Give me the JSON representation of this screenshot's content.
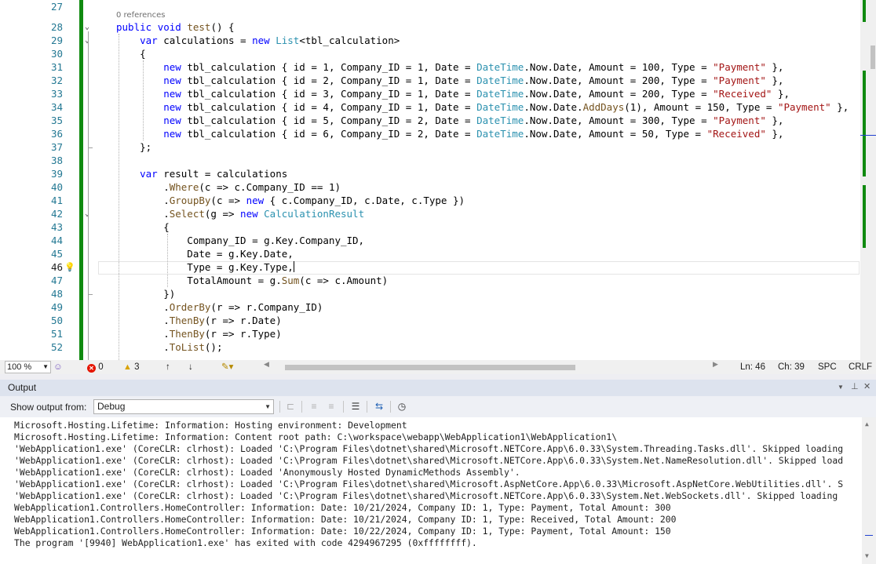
{
  "editor": {
    "references": "0 references",
    "line_numbers": [
      "27",
      "28",
      "29",
      "30",
      "31",
      "32",
      "33",
      "34",
      "35",
      "36",
      "37",
      "38",
      "39",
      "40",
      "41",
      "42",
      "43",
      "44",
      "45",
      "46",
      "47",
      "48",
      "49",
      "50",
      "51",
      "52"
    ],
    "current_line": "46"
  },
  "status": {
    "zoom": "100 %",
    "errors": "0",
    "warnings": "3",
    "ln": "Ln: 46",
    "ch": "Ch: 39",
    "spc": "SPC",
    "crlf": "CRLF"
  },
  "output": {
    "title": "Output",
    "show_from_label": "Show output from:",
    "source": "Debug",
    "lines": [
      "Microsoft.Hosting.Lifetime: Information: Hosting environment: Development",
      "Microsoft.Hosting.Lifetime: Information: Content root path: C:\\workspace\\webapp\\WebApplication1\\WebApplication1\\",
      "'WebApplication1.exe' (CoreCLR: clrhost): Loaded 'C:\\Program Files\\dotnet\\shared\\Microsoft.NETCore.App\\6.0.33\\System.Threading.Tasks.dll'. Skipped loading",
      "'WebApplication1.exe' (CoreCLR: clrhost): Loaded 'C:\\Program Files\\dotnet\\shared\\Microsoft.NETCore.App\\6.0.33\\System.Net.NameResolution.dll'. Skipped load",
      "'WebApplication1.exe' (CoreCLR: clrhost): Loaded 'Anonymously Hosted DynamicMethods Assembly'.",
      "'WebApplication1.exe' (CoreCLR: clrhost): Loaded 'C:\\Program Files\\dotnet\\shared\\Microsoft.AspNetCore.App\\6.0.33\\Microsoft.AspNetCore.WebUtilities.dll'. S",
      "'WebApplication1.exe' (CoreCLR: clrhost): Loaded 'C:\\Program Files\\dotnet\\shared\\Microsoft.NETCore.App\\6.0.33\\System.Net.WebSockets.dll'. Skipped loading",
      "WebApplication1.Controllers.HomeController: Information: Date: 10/21/2024, Company ID: 1, Type: Payment, Total Amount: 300",
      "WebApplication1.Controllers.HomeController: Information: Date: 10/21/2024, Company ID: 1, Type: Received, Total Amount: 200",
      "WebApplication1.Controllers.HomeController: Information: Date: 10/22/2024, Company ID: 1, Type: Payment, Total Amount: 150",
      "The program '[9940] WebApplication1.exe' has exited with code 4294967295 (0xffffffff)."
    ]
  },
  "colors": {
    "green_change_bar": "#108a10",
    "keyword": "#0000ff",
    "type": "#2b91af",
    "string": "#a31515",
    "method": "#74531f",
    "line_number": "#237893"
  },
  "icons": [
    "fold-chevron-icon",
    "lightbulb-icon",
    "error-icon",
    "warning-icon",
    "arrow-up-icon",
    "arrow-down-icon",
    "brush-icon",
    "output-clear-icon",
    "word-wrap-icon",
    "clock-icon",
    "pin-icon",
    "close-icon"
  ]
}
